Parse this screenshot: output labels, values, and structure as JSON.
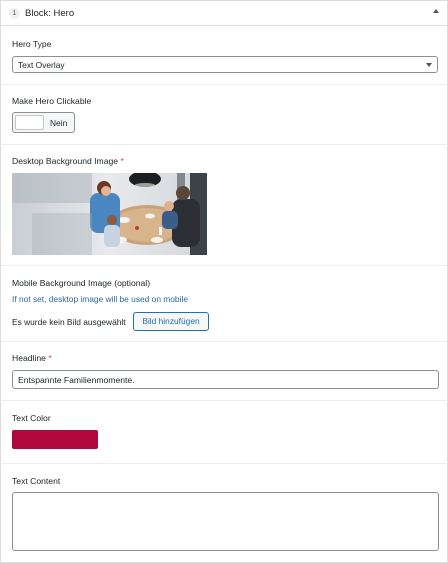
{
  "block": {
    "number": "1",
    "title": "Block: Hero"
  },
  "hero_type": {
    "label": "Hero Type",
    "value": "Text Overlay"
  },
  "clickable": {
    "label": "Make Hero Clickable",
    "toggle_text": "Nein"
  },
  "desktop_bg": {
    "label": "Desktop Background Image",
    "required_mark": "*"
  },
  "mobile_bg": {
    "label": "Mobile Background Image (optional)",
    "description": "If not set, desktop image will be used on mobile",
    "no_selection_text": "Es wurde kein Bild ausgewählt",
    "add_button": "Bild hinzufügen"
  },
  "headline": {
    "label": "Headline",
    "required_mark": "*",
    "value": "Entspannte Familienmomente."
  },
  "text_color": {
    "label": "Text Color",
    "value": "#b0073f"
  },
  "text_content": {
    "label": "Text Content",
    "value": ""
  },
  "icons": {
    "collapse": "caret-up-icon",
    "select": "chevron-down-icon"
  }
}
